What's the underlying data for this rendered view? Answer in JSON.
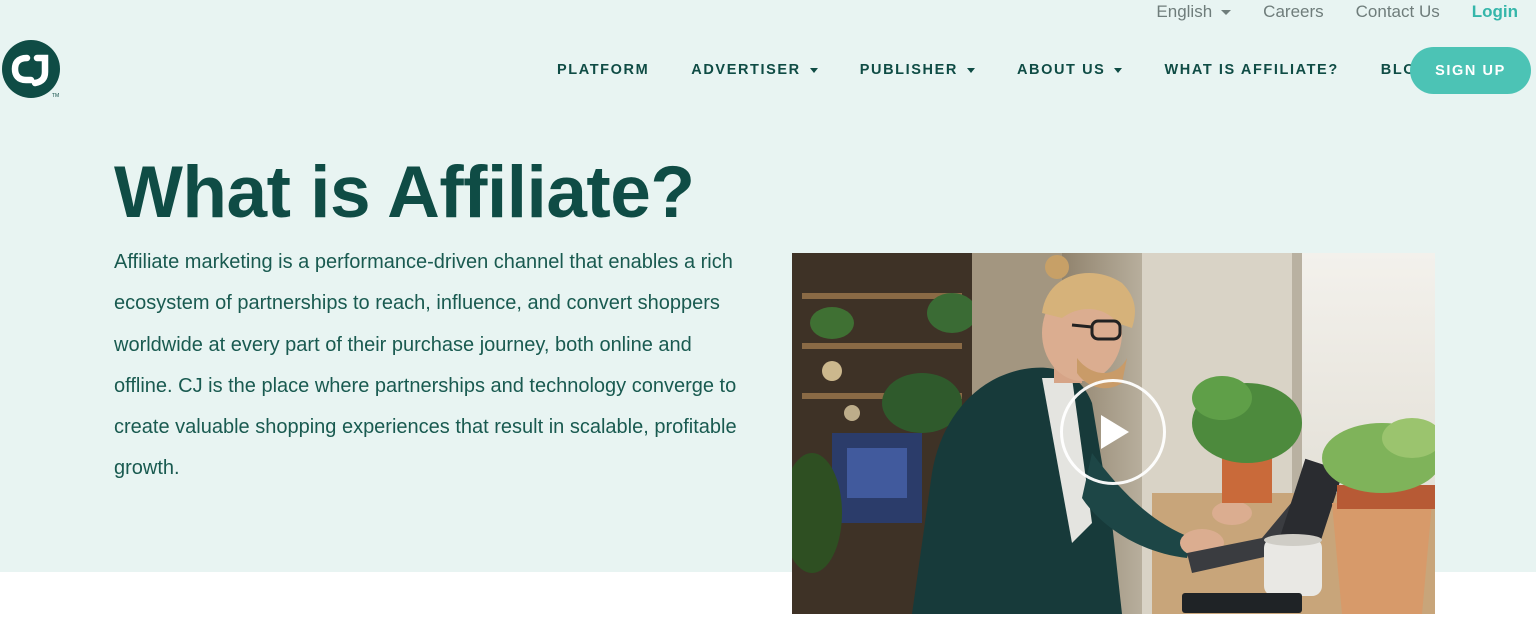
{
  "utility_nav": {
    "language": "English",
    "careers": "Careers",
    "contact": "Contact Us",
    "login": "Login"
  },
  "logo": {
    "text": "CJ",
    "tm": "TM",
    "icon": "cj-logo-icon"
  },
  "main_nav": {
    "items": [
      {
        "label": "PLATFORM",
        "has_dropdown": false
      },
      {
        "label": "ADVERTISER",
        "has_dropdown": true
      },
      {
        "label": "PUBLISHER",
        "has_dropdown": true
      },
      {
        "label": "ABOUT US",
        "has_dropdown": true
      },
      {
        "label": "WHAT IS AFFILIATE?",
        "has_dropdown": false
      },
      {
        "label": "BLOG",
        "has_dropdown": false
      }
    ],
    "cta": "SIGN UP"
  },
  "hero": {
    "title": "What is Affiliate?",
    "body": "Affiliate marketing is a performance-driven channel that enables a rich ecosystem of partnerships to reach, influence, and convert shoppers worldwide at every part of their purchase journey, both online and offline. CJ is the place where partnerships and technology converge to create valuable shopping experiences that result in scalable, profitable growth."
  },
  "video": {
    "icon": "play-icon"
  },
  "colors": {
    "brand_dark": "#0f4c45",
    "accent_teal": "#4cc3b5",
    "login_teal": "#35b6aa",
    "hero_background": "#e8f4f2"
  }
}
